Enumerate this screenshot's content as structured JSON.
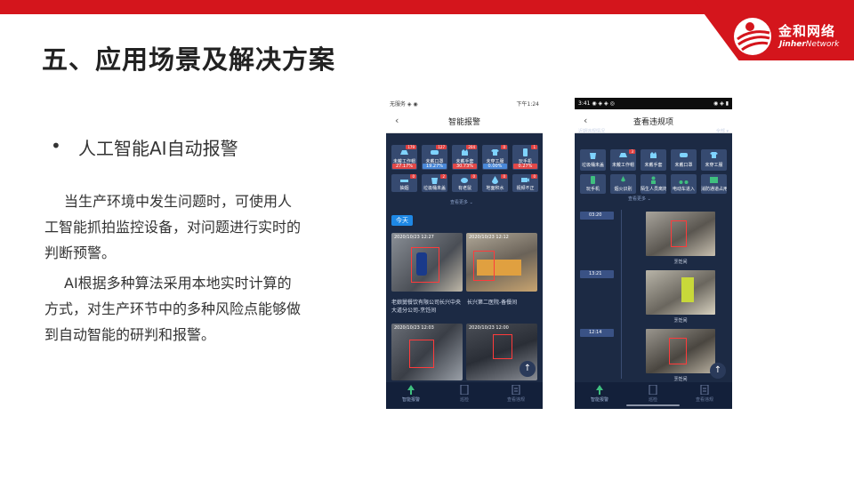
{
  "logo": {
    "cn": "金和网络",
    "en_bold": "Jinher",
    "en_light": "Network"
  },
  "page": {
    "title": "五、应用场景及解决方案",
    "bullet_mark": "•",
    "bullet": "人工智能AI自动报警",
    "paragraphs": [
      "当生产环境中发生问题时，可使用人工智能抓拍监控设备，对问题进行实时的判断预警。",
      "AI根据多种算法采用本地实时计算的方式，对生产环节中的多种风险点能够做到自动智能的研判和报警。"
    ]
  },
  "phone1": {
    "status_left": "无服务 ◈ ◉",
    "status_right": "下午1:24",
    "nav_back": "‹",
    "title": "智能报警",
    "cards": [
      {
        "label": "未戴工作帽",
        "badge": "179",
        "pct": "27.17%",
        "pct_color": "#e04848"
      },
      {
        "label": "未戴口罩",
        "badge": "127",
        "pct": "19.27%",
        "pct_color": "#4a88d8"
      },
      {
        "label": "未戴手套",
        "badge": "204",
        "pct": "30.73%",
        "pct_color": "#e04848"
      },
      {
        "label": "未穿工服",
        "badge": "0",
        "pct": "0.00%",
        "pct_color": "#4a88d8"
      },
      {
        "label": "玩手机",
        "badge": "1",
        "pct": "0.27%",
        "pct_color": "#e04848"
      },
      {
        "label": "抽烟",
        "badge": "0"
      },
      {
        "label": "垃圾桶未盖",
        "badge": "2"
      },
      {
        "label": "有老鼠",
        "badge": "0"
      },
      {
        "label": "地面积水",
        "badge": "0"
      },
      {
        "label": "视频不正",
        "badge": "0"
      }
    ],
    "see_more": "查看更多 ⌄",
    "today": "今天",
    "snapshots": [
      {
        "time": "2020/10/23 12:27",
        "label": "老娘舅餐饮有限公司长兴中央大道分公司-烹饪间"
      },
      {
        "time": "2020/10/23 12:12",
        "label": "长兴第二医院-备餐间"
      },
      {
        "time": "2020/10/23 12:03",
        "label": ""
      },
      {
        "time": "2020/10/23 12:00",
        "label": ""
      }
    ],
    "tabs": [
      "智能报警",
      "巡检",
      "查看违规"
    ],
    "up_arrow": "↑"
  },
  "phone2": {
    "status_left": "3:41 ◉ ◈ ◈ ◎",
    "status_right": "◉ ◈ ▮",
    "nav_back": "‹",
    "title": "查看违规项",
    "filter_left": "近期违规情况",
    "filter_right": "全部 ▾",
    "cards": [
      {
        "label": "垃圾桶未盖",
        "badge": ""
      },
      {
        "label": "未戴工作帽",
        "badge": "3"
      },
      {
        "label": "未戴手套",
        "badge": ""
      },
      {
        "label": "未戴口罩",
        "badge": ""
      },
      {
        "label": "未穿工服",
        "badge": ""
      },
      {
        "label": "玩手机",
        "badge": ""
      },
      {
        "label": "烟火识别",
        "badge": ""
      },
      {
        "label": "陌生人员离岗",
        "badge": ""
      },
      {
        "label": "电动车进入",
        "badge": ""
      },
      {
        "label": "消防通道占用",
        "badge": ""
      }
    ],
    "see_more": "查看更多 ⌄",
    "timeline": [
      {
        "time": "03:20",
        "label": "烹饪间"
      },
      {
        "time": "13:21",
        "label": "烹饪间"
      },
      {
        "time": "12:14",
        "label": "烹饪间"
      }
    ],
    "tabs": [
      "智能报警",
      "巡检",
      "查看违规"
    ],
    "up_arrow": "↑"
  },
  "colors": {
    "brand_red": "#d4151c",
    "phone_bg": "#1c2a44",
    "card_bg": "#364a70",
    "accent_blue": "#1e88e5"
  }
}
